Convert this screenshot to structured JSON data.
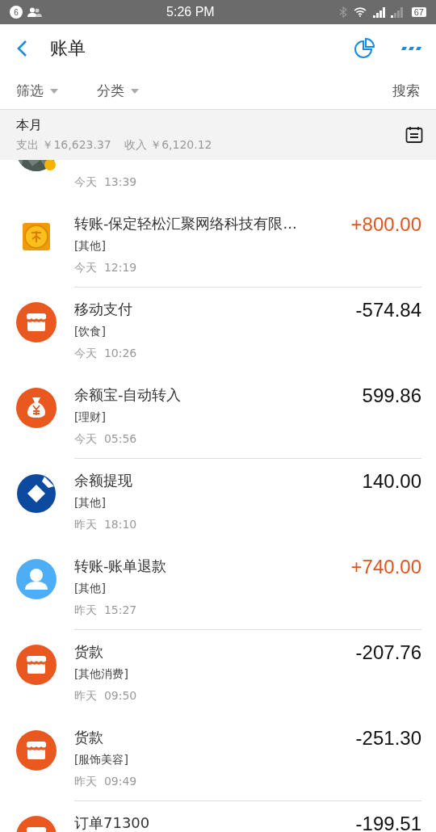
{
  "status_bar": {
    "notification_count": "6",
    "time": "5:26 PM",
    "battery": "67"
  },
  "header": {
    "title": "账单"
  },
  "filters": [
    {
      "label": "筛选",
      "kind": "dropdown"
    },
    {
      "label": "分类",
      "kind": "dropdown"
    },
    {
      "label": "搜索",
      "kind": "link"
    }
  ],
  "summary": {
    "period": "本月",
    "expense_label": "支出",
    "expense": "￥16,623.37",
    "income_label": "收入",
    "income": "￥6,120.12"
  },
  "transactions": [
    {
      "time": "今天  13:39",
      "divider_below": false
    },
    {
      "kind": "coin",
      "title": "转账-保定轻松汇聚网络科技有限...",
      "category": "[其他]",
      "time": "今天  12:19",
      "amount": "+800.00",
      "income": true,
      "divider_below": true
    },
    {
      "kind": "shop",
      "title": "移动支付",
      "category": "[饮食]",
      "time": "今天  10:26",
      "amount": "-574.84",
      "income": false,
      "divider_below": false
    },
    {
      "kind": "moneybag",
      "title": "余额宝-自动转入",
      "category": "[理财]",
      "time": "今天  05:56",
      "amount": "599.86",
      "income": false,
      "divider_below": true
    },
    {
      "kind": "bank",
      "title": "余额提现",
      "category": "[其他]",
      "time": "昨天  18:10",
      "amount": "140.00",
      "income": false,
      "divider_below": false
    },
    {
      "kind": "person",
      "title": "转账-账单退款",
      "category": "[其他]",
      "time": "昨天  15:27",
      "amount": "+740.00",
      "income": true,
      "divider_below": true
    },
    {
      "kind": "shop",
      "title": "货款",
      "category": "[其他消费]",
      "time": "昨天  09:50",
      "amount": "-207.76",
      "income": false,
      "divider_below": false
    },
    {
      "kind": "shop",
      "title": "货款",
      "category": "[服饰美容]",
      "time": "昨天  09:49",
      "amount": "-251.30",
      "income": false,
      "divider_below": true
    },
    {
      "kind": "shop",
      "title": "订单71300",
      "amount": "-199.51",
      "income": false,
      "divider_below": false
    }
  ]
}
